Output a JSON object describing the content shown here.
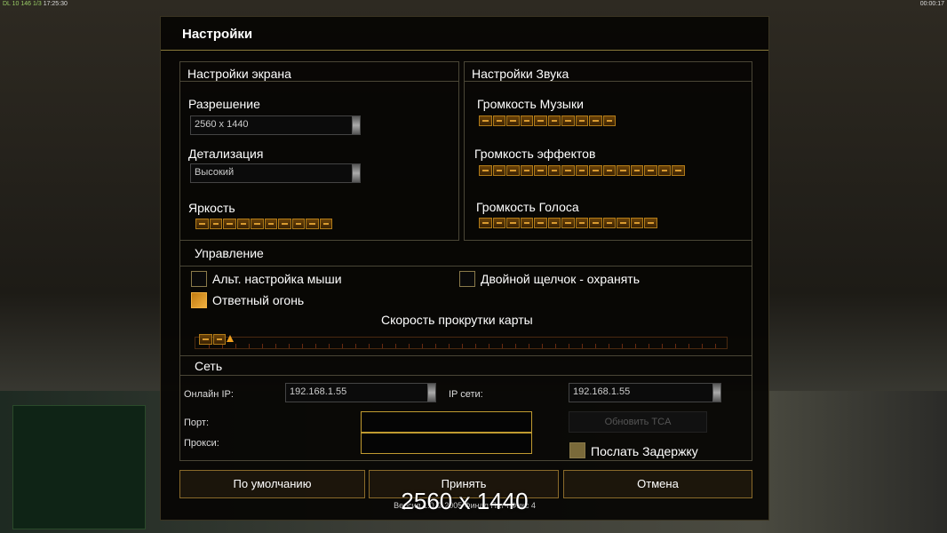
{
  "hud": {
    "left": "DL 10 146 1/3",
    "clock": "17:25:30",
    "right": "00:00:17"
  },
  "dialog": {
    "title": "Настройки"
  },
  "screen": {
    "header": "Настройки экрана",
    "resolution_label": "Разрешение",
    "resolution_value": "2560 x 1440",
    "detail_label": "Детализация",
    "detail_value": "Высокий",
    "brightness_label": "Яркость",
    "brightness_level": 10
  },
  "sound": {
    "header": "Настройки Звука",
    "music_label": "Громкость Музыки",
    "music_level": 10,
    "effects_label": "Громкость эффектов",
    "effects_level": 15,
    "voice_label": "Громкость Голоса",
    "voice_level": 13
  },
  "controls": {
    "header": "Управление",
    "alt_mouse": {
      "label": "Альт. настройка мыши",
      "checked": false
    },
    "double_click": {
      "label": "Двойной щелчок - охранять",
      "checked": false
    },
    "return_fire": {
      "label": "Ответный огонь",
      "checked": true
    },
    "scroll_label": "Скорость прокрутки карты",
    "scroll_percent": 5
  },
  "network": {
    "header": "Сеть",
    "online_ip_label": "Онлайн IP:",
    "online_ip_value": "192.168.1.55",
    "lan_ip_label": "IP сети:",
    "lan_ip_value": "192.168.1.55",
    "port_label": "Порт:",
    "port_value": "",
    "proxy_label": "Прокси:",
    "proxy_value": "",
    "update_tca_label": "Обновить TCA",
    "send_delay": {
      "label": "Послать Задержку",
      "checked": true
    }
  },
  "buttons": {
    "defaults": "По умолчанию",
    "accept": "Принять",
    "cancel": "Отмена"
  },
  "version": "Версия 1.0 © 2005 Финал Патч Фикс 4",
  "overlay": "2560 x 1440",
  "colors": {
    "accent": "#c09a30",
    "segment": "#b07a18"
  }
}
